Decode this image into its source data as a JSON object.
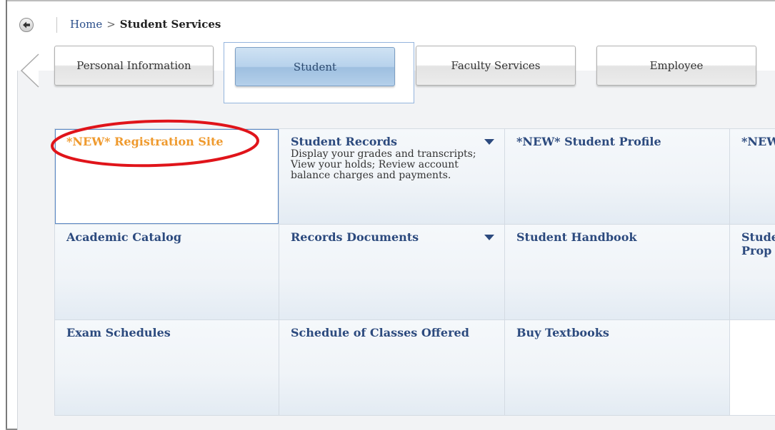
{
  "breadcrumb": {
    "home": "Home",
    "separator": ">",
    "current": "Student Services"
  },
  "tabs": [
    {
      "label": "Personal Information",
      "active": false
    },
    {
      "label": "Student",
      "active": true
    },
    {
      "label": "Faculty Services",
      "active": false
    },
    {
      "label": "Employee",
      "active": false
    }
  ],
  "grid": {
    "cells": [
      {
        "title": "*NEW* Registration Site",
        "highlight": true
      },
      {
        "title": "Student Records",
        "desc": "Display your grades and transcripts; View your holds; Review account balance charges and payments.",
        "dropdown": true
      },
      {
        "title": "*NEW* Student Profile"
      },
      {
        "title": "*NEW"
      },
      {
        "title": "Academic Catalog"
      },
      {
        "title": "Records Documents",
        "dropdown": true
      },
      {
        "title": "Student Handbook"
      },
      {
        "title": "Stude",
        "title2": "Prop"
      },
      {
        "title": "Exam Schedules"
      },
      {
        "title": "Schedule of Classes Offered"
      },
      {
        "title": "Buy Textbooks"
      },
      {
        "title": ""
      }
    ]
  },
  "icons": {
    "back": "back-arrow-icon",
    "prev": "chevron-left-icon",
    "dropdown": "caret-down-icon"
  },
  "colors": {
    "link": "#2c4a7e",
    "new_link": "#ef9a2e",
    "annotation": "#e0141a",
    "active_tab": "#b7d2ec"
  }
}
